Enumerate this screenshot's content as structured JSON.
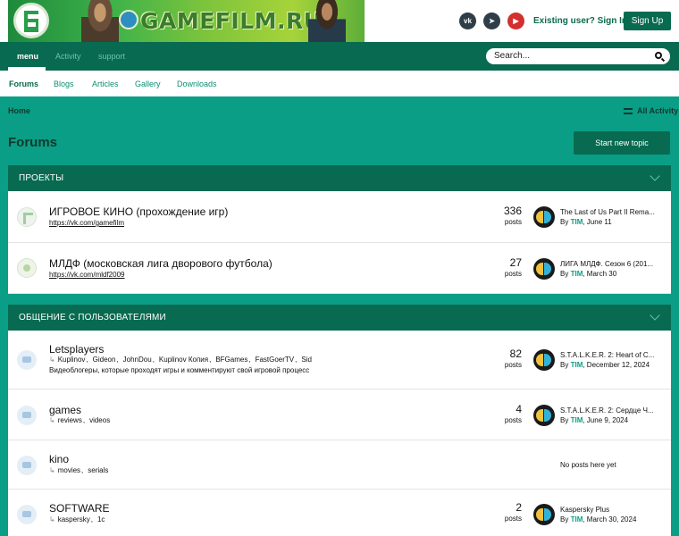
{
  "header": {
    "site_name": "GAMEFILM.RU",
    "signin_label": "Existing user? Sign In",
    "signup_label": "Sign Up",
    "social": [
      "vk-icon",
      "telegram-icon",
      "youtube-icon"
    ]
  },
  "nav": {
    "tabs": [
      {
        "label": "menu",
        "active": true
      },
      {
        "label": "Activity",
        "active": false
      },
      {
        "label": "support",
        "active": false
      }
    ],
    "search_placeholder": "Search..."
  },
  "subnav": {
    "items": [
      {
        "label": "Forums",
        "active": true
      },
      {
        "label": "Blogs"
      },
      {
        "label": "Articles"
      },
      {
        "label": "Gallery"
      },
      {
        "label": "Downloads"
      }
    ]
  },
  "breadcrumb": "Home",
  "all_activity": "All Activity",
  "page_title": "Forums",
  "start_topic": "Start new topic",
  "categories": [
    {
      "title": "ПРОЕКТЫ",
      "forums": [
        {
          "name": "ИГРОВОЕ КИНО (прохождение игр)",
          "link": "https://vk.com/gamefilm",
          "count": "336",
          "count_label": "posts",
          "last_title": "The Last of Us Part II Rema...",
          "by": "By",
          "user": "TIM",
          "date": ", June 11"
        },
        {
          "name": "МЛДФ (московская лига дворового футбола)",
          "link": "https://vk.com/mldf2009",
          "count": "27",
          "count_label": "posts",
          "last_title": "ЛИГА МЛДФ. Сезон 6 (201...",
          "by": "By",
          "user": "TIM",
          "date": ", March 30"
        }
      ]
    },
    {
      "title": "ОБЩЕНИЕ С ПОЛЬЗОВАТЕЛЯМИ",
      "forums": [
        {
          "name": "Letsplayers",
          "subforums": [
            "Kuplinov",
            "Gideon",
            "JohnDou",
            "Kuplinov Копия",
            "BFGames",
            "FastGoerTV",
            "Sid"
          ],
          "desc": "Видеоблогеры, которые проходят игры и комментируют свой игровой процесс",
          "count": "82",
          "count_label": "posts",
          "last_title": "S.T.A.L.K.E.R. 2: Heart of C...",
          "by": "By",
          "user": "TIM",
          "date": ", December 12, 2024"
        },
        {
          "name": "games",
          "subforums": [
            "reviews",
            "videos"
          ],
          "count": "4",
          "count_label": "posts",
          "last_title": "S.T.A.L.K.E.R. 2: Сердце Ч...",
          "by": "By",
          "user": "TIM",
          "date": ", June 9, 2024"
        },
        {
          "name": "kino",
          "subforums": [
            "movies",
            "serials"
          ],
          "no_posts": "No posts here yet"
        },
        {
          "name": "SOFTWARE",
          "subforums": [
            "kaspersky",
            "1c"
          ],
          "count": "2",
          "count_label": "posts",
          "last_title": "Kaspersky Plus",
          "by": "By",
          "user": "TIM",
          "date": ", March 30, 2024"
        }
      ]
    }
  ],
  "colors": {
    "primary": "#086a50",
    "accent": "#0b9e86",
    "link": "#0b8f73"
  }
}
